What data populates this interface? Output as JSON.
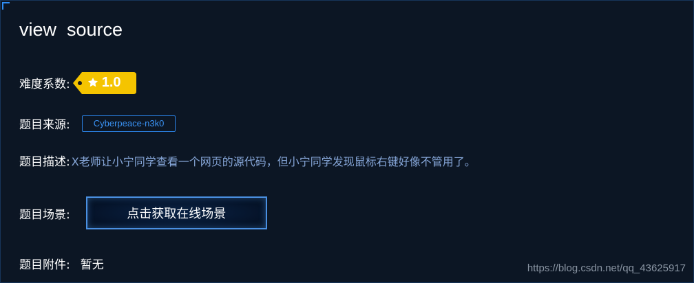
{
  "challenge": {
    "title": "view  source",
    "difficulty": {
      "label": "难度系数:",
      "value": "1.0",
      "star_icon": "star-icon",
      "badge_color": "#f5c400"
    },
    "source": {
      "label": "题目来源:",
      "value": "Cyberpeace-n3k0"
    },
    "description": {
      "label": "题目描述:",
      "value": "X老师让小宁同学查看一个网页的源代码，但小宁同学发现鼠标右键好像不管用了。"
    },
    "scene": {
      "label": "题目场景:",
      "button_label": "点击获取在线场景"
    },
    "attachment": {
      "label": "题目附件:",
      "value": "暂无"
    }
  },
  "watermark": "https://blog.csdn.net/qq_43625917"
}
